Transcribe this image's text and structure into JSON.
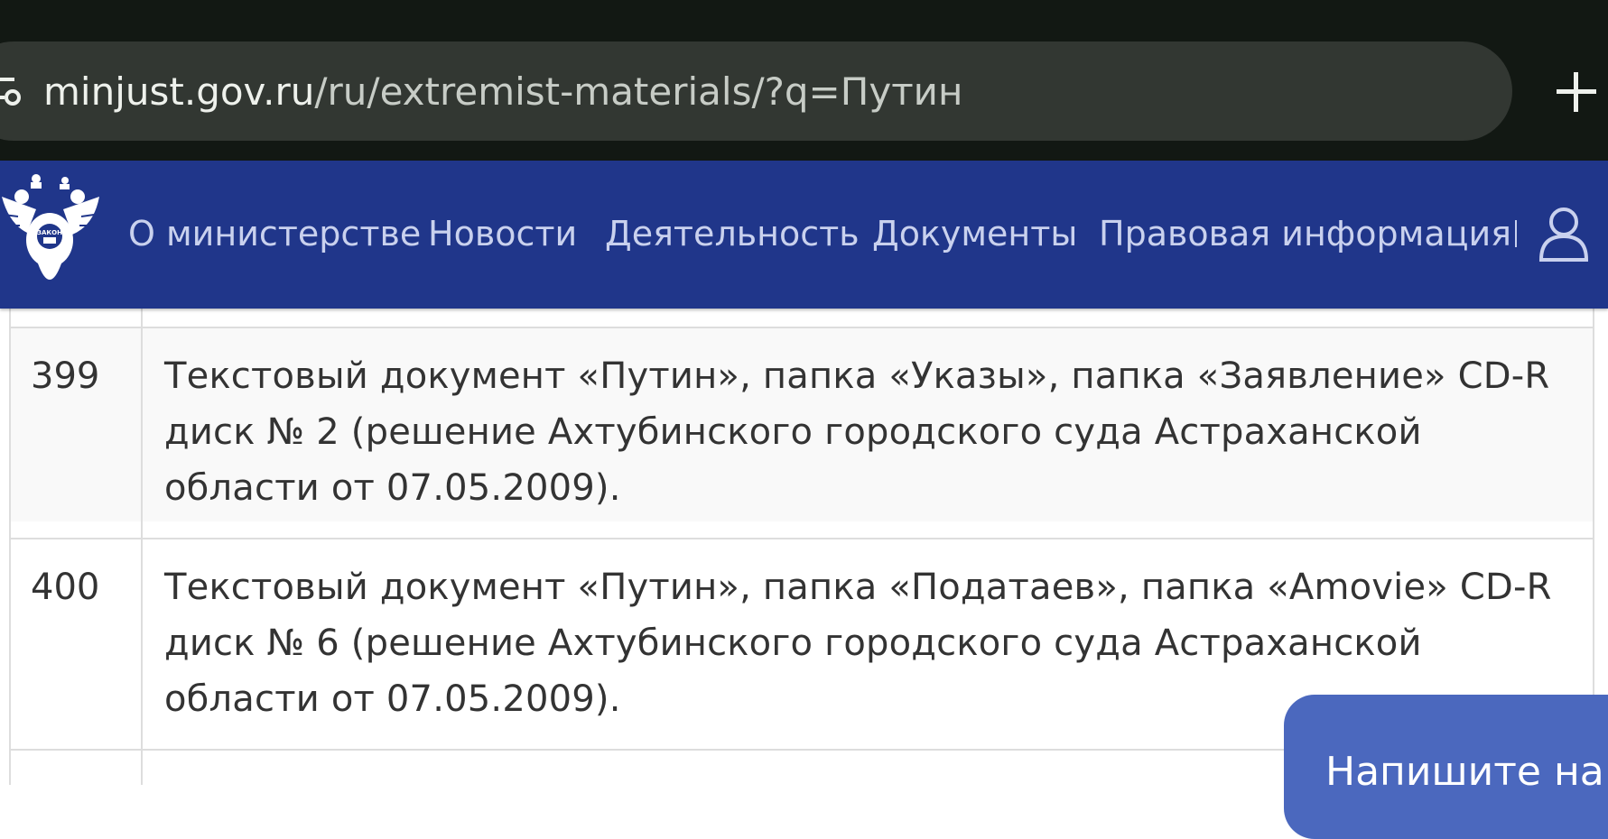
{
  "browser": {
    "url_host": "minjust.gov.ru",
    "url_path": "/ru/extremist-materials/?q=Путин",
    "new_tab_icon": "plus-icon",
    "site_info_icon": "tune-icon"
  },
  "navbar": {
    "logo_icon": "double-headed-eagle-emblem",
    "items": [
      {
        "label": "О министерстве"
      },
      {
        "label": "Новости"
      },
      {
        "label": "Деятельность"
      },
      {
        "label": "Документы"
      },
      {
        "label": "Правовая информация"
      }
    ],
    "user_icon": "user-icon",
    "bg_color": "#20368a"
  },
  "table": {
    "rows": [
      {
        "number": "399",
        "text": "Текстовый документ «Путин», папка «Указы», папка «Заявление» CD-R диск № 2 (решение Ахтубинского городского суда Астраханской области от 07.05.2009)."
      },
      {
        "number": "400",
        "text": "Текстовый документ «Путин», папка «Податаев», папка «Amovie» CD-R диск № 6 (решение Ахтубинского городского суда Астраханской области от 07.05.2009)."
      }
    ]
  },
  "chat_widget": {
    "label": "Напишите на",
    "bg_color": "#4b68be"
  }
}
